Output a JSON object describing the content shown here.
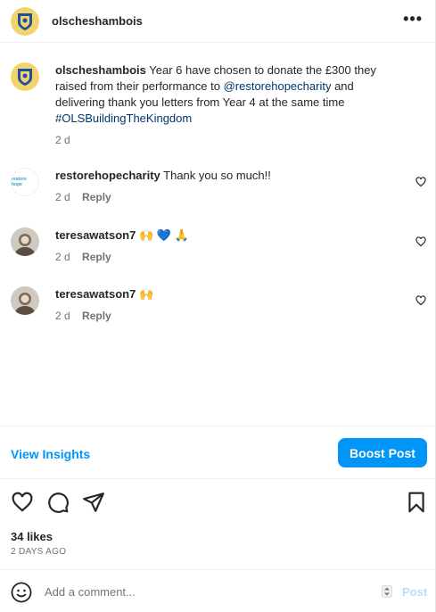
{
  "header": {
    "username": "olscheshambois",
    "more_icon": "more-horizontal-icon"
  },
  "caption": {
    "username": "olscheshambois",
    "text_1": "Year 6 have chosen to donate the £300 they raised from their performance to ",
    "mention": "@restorehopecharity",
    "text_2": " and delivering thank you letters from Year 4 at the same time ",
    "hashtag": "#OLSBuildingTheKingdom",
    "time": "2 d"
  },
  "comments": [
    {
      "username": "restorehopecharity",
      "text": "Thank you so much!!",
      "time": "2 d",
      "reply": "Reply",
      "avatar_logo": "restore hope"
    },
    {
      "username": "teresawatson7",
      "text": "🙌 💙 🙏",
      "time": "2 d",
      "reply": "Reply"
    },
    {
      "username": "teresawatson7",
      "text": "🙌",
      "time": "2 d",
      "reply": "Reply"
    }
  ],
  "insights": {
    "view_label": "View Insights",
    "boost_label": "Boost Post"
  },
  "stats": {
    "likes": "34 likes",
    "date": "2 DAYS AGO"
  },
  "add_comment": {
    "placeholder": "Add a comment...",
    "post_label": "Post"
  },
  "colors": {
    "accent": "#0095f6",
    "link": "#00376b",
    "muted": "#737373",
    "post_disabled": "#b2dffc"
  }
}
